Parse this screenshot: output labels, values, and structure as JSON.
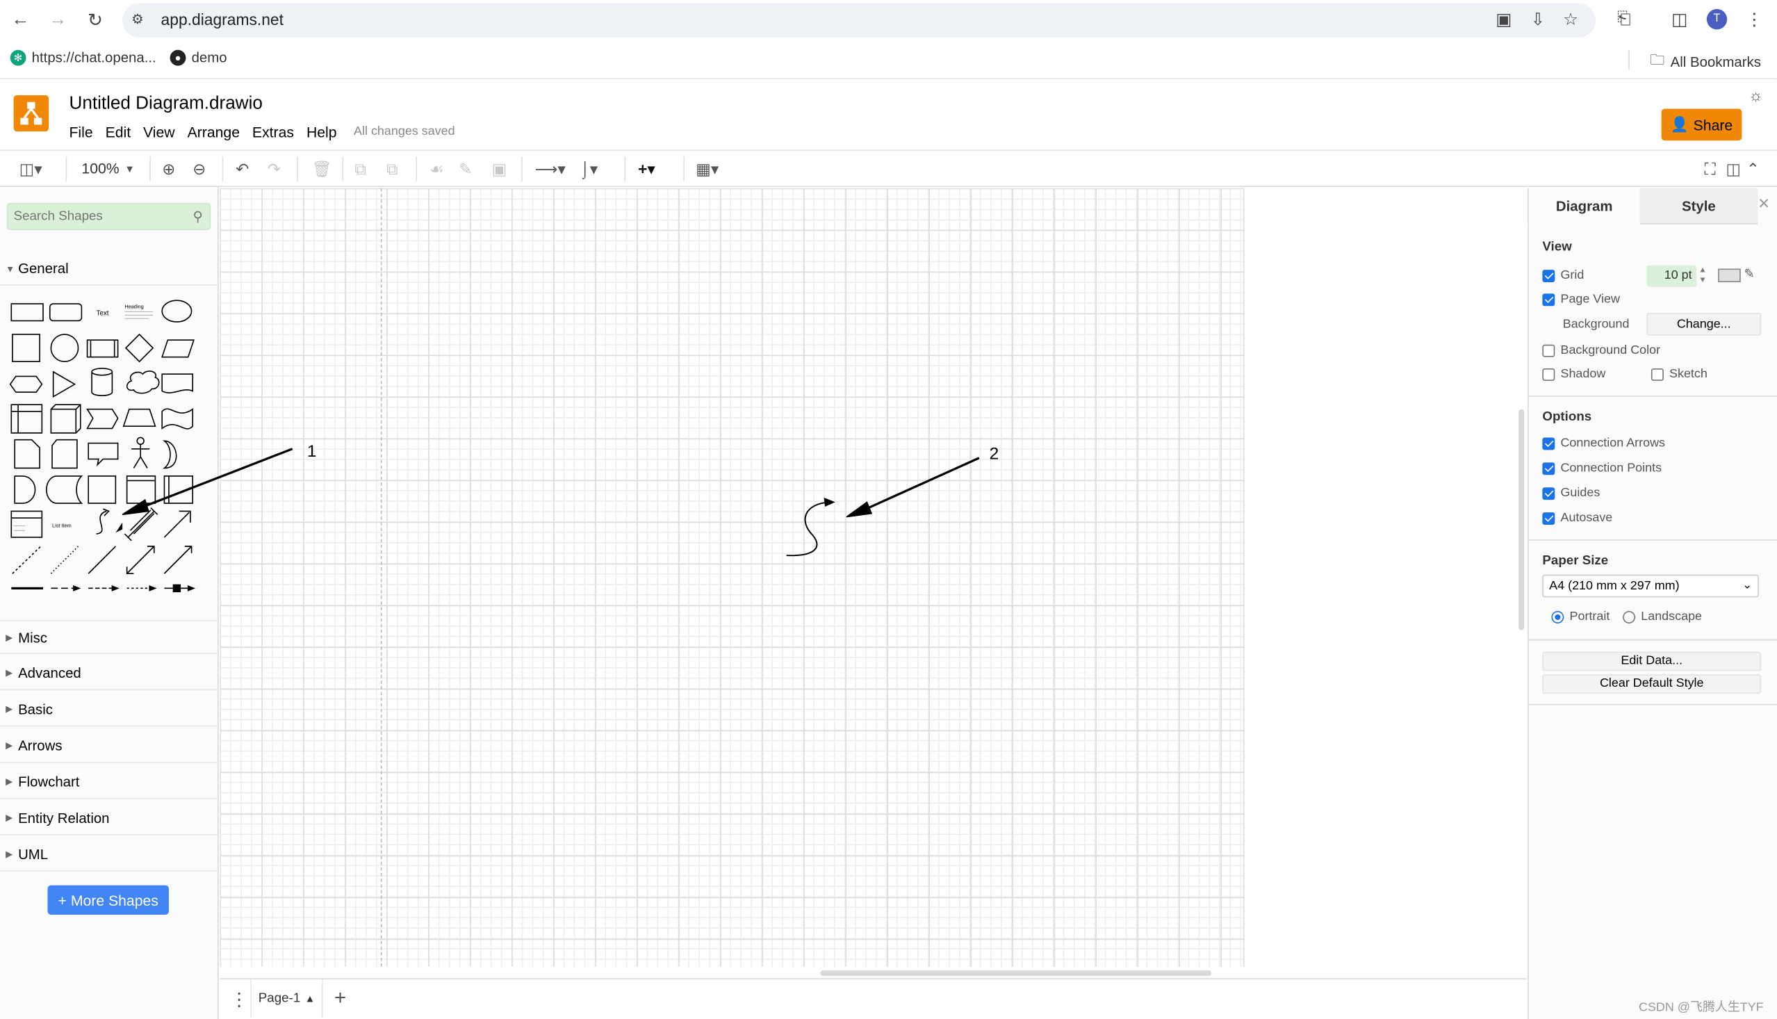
{
  "browser": {
    "url": "app.diagrams.net",
    "avatar_initial": "T",
    "bookmarks": [
      {
        "label": "https://chat.opena..."
      },
      {
        "label": "demo"
      }
    ],
    "all_bookmarks": "All Bookmarks"
  },
  "app": {
    "doc_title": "Untitled Diagram.drawio",
    "menu": [
      "File",
      "Edit",
      "View",
      "Arrange",
      "Extras",
      "Help"
    ],
    "save_status": "All changes saved",
    "share_label": "Share",
    "brand_color": "#f08705"
  },
  "toolbar": {
    "zoom": "100%"
  },
  "left_panel": {
    "search_placeholder": "Search Shapes",
    "sections": [
      "General",
      "Misc",
      "Advanced",
      "Basic",
      "Arrows",
      "Flowchart",
      "Entity Relation",
      "UML"
    ],
    "shape_labels": {
      "text": "Text",
      "heading": "Heading",
      "list_item": "List Item"
    },
    "more_shapes": "+ More Shapes"
  },
  "canvas": {
    "annotations": [
      "1",
      "2"
    ]
  },
  "page_tabs": {
    "current": "Page-1"
  },
  "right_panel": {
    "tabs": [
      "Diagram",
      "Style"
    ],
    "view_label": "View",
    "grid_label": "Grid",
    "grid_checked": true,
    "grid_size": "10 pt",
    "page_view_label": "Page View",
    "page_view_checked": true,
    "background_label": "Background",
    "change_btn": "Change...",
    "background_color_label": "Background Color",
    "shadow_label": "Shadow",
    "sketch_label": "Sketch",
    "options_label": "Options",
    "options": [
      {
        "label": "Connection Arrows",
        "checked": true
      },
      {
        "label": "Connection Points",
        "checked": true
      },
      {
        "label": "Guides",
        "checked": true
      },
      {
        "label": "Autosave",
        "checked": true
      }
    ],
    "paper_size_label": "Paper Size",
    "paper_size_value": "A4 (210 mm x 297 mm)",
    "portrait_label": "Portrait",
    "landscape_label": "Landscape",
    "orientation": "Portrait",
    "edit_data_btn": "Edit Data...",
    "clear_style_btn": "Clear Default Style"
  },
  "watermark": "CSDN @飞腾人生TYF"
}
